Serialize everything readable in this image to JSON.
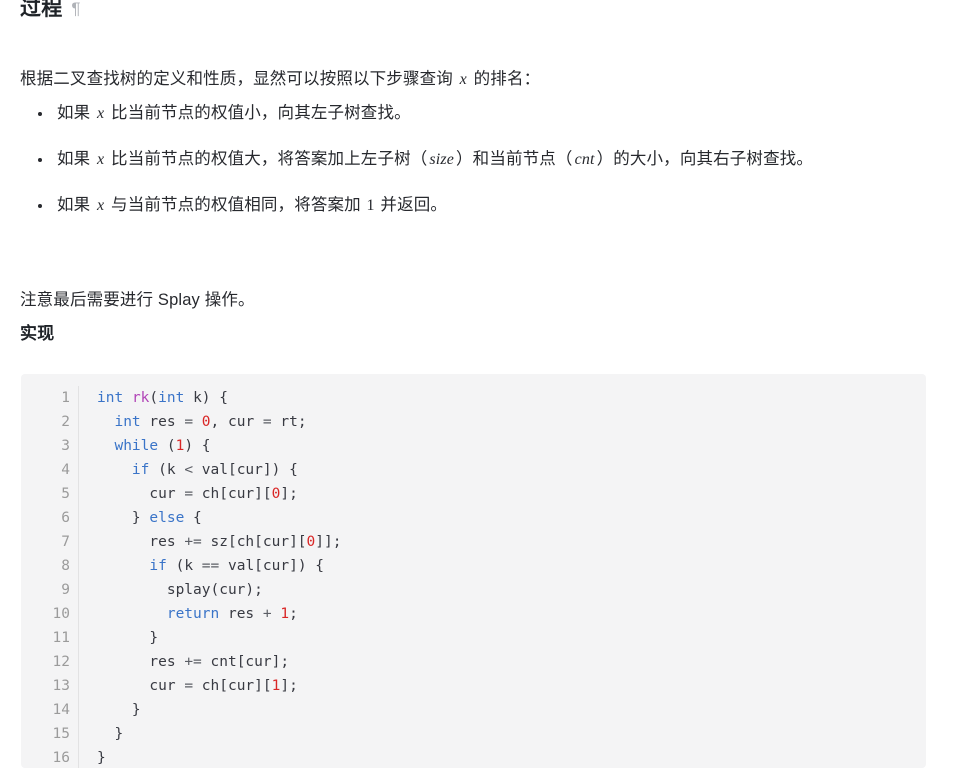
{
  "headings": {
    "section": "过程",
    "pilcrow": "¶",
    "sub": "实现"
  },
  "intro": {
    "before_var": "根据二叉查找树的定义和性质，显然可以按照以下步骤查询 ",
    "var": "x",
    "after_var": " 的排名："
  },
  "bullets": [
    {
      "p1": "如果 ",
      "m1": "x",
      "p2": " 比当前节点的权值小，向其左子树查找。",
      "m2": "",
      "p3": "",
      "m3": "",
      "p4": ""
    },
    {
      "p1": "如果 ",
      "m1": "x",
      "p2": " 比当前节点的权值大，将答案加上左子树（",
      "m2": "size",
      "p3": "）和当前节点（",
      "m3": "cnt",
      "p4": "）的大小，向其右子树查找。"
    },
    {
      "p1": "如果 ",
      "m1": "x",
      "p2": " 与当前节点的权值相同，将答案加 ",
      "m2": "1",
      "p3": " 并返回。",
      "m3": "",
      "p4": ""
    }
  ],
  "splay_note": "注意最后需要进行 Splay 操作。",
  "code": {
    "language": "cpp",
    "line_numbers": [
      "1",
      "2",
      "3",
      "4",
      "5",
      "6",
      "7",
      "8",
      "9",
      "10",
      "11",
      "12",
      "13",
      "14",
      "15",
      "16"
    ],
    "lines": [
      [
        {
          "t": "int",
          "c": "kw"
        },
        {
          "t": " ",
          "c": "pl"
        },
        {
          "t": "rk",
          "c": "fn"
        },
        {
          "t": "(",
          "c": "pl"
        },
        {
          "t": "int",
          "c": "kw"
        },
        {
          "t": " k) {",
          "c": "pl"
        }
      ],
      [
        {
          "t": "  ",
          "c": "pl"
        },
        {
          "t": "int",
          "c": "kw"
        },
        {
          "t": " res ",
          "c": "pl"
        },
        {
          "t": "=",
          "c": "op"
        },
        {
          "t": " ",
          "c": "pl"
        },
        {
          "t": "0",
          "c": "num"
        },
        {
          "t": ", cur ",
          "c": "pl"
        },
        {
          "t": "=",
          "c": "op"
        },
        {
          "t": " rt;",
          "c": "pl"
        }
      ],
      [
        {
          "t": "  ",
          "c": "pl"
        },
        {
          "t": "while",
          "c": "kw"
        },
        {
          "t": " (",
          "c": "pl"
        },
        {
          "t": "1",
          "c": "num"
        },
        {
          "t": ") {",
          "c": "pl"
        }
      ],
      [
        {
          "t": "    ",
          "c": "pl"
        },
        {
          "t": "if",
          "c": "kw"
        },
        {
          "t": " (k ",
          "c": "pl"
        },
        {
          "t": "<",
          "c": "op"
        },
        {
          "t": " val[cur]) {",
          "c": "pl"
        }
      ],
      [
        {
          "t": "      cur ",
          "c": "pl"
        },
        {
          "t": "=",
          "c": "op"
        },
        {
          "t": " ch[cur][",
          "c": "pl"
        },
        {
          "t": "0",
          "c": "num"
        },
        {
          "t": "];",
          "c": "pl"
        }
      ],
      [
        {
          "t": "    } ",
          "c": "pl"
        },
        {
          "t": "else",
          "c": "kw"
        },
        {
          "t": " {",
          "c": "pl"
        }
      ],
      [
        {
          "t": "      res ",
          "c": "pl"
        },
        {
          "t": "+=",
          "c": "op"
        },
        {
          "t": " sz[ch[cur][",
          "c": "pl"
        },
        {
          "t": "0",
          "c": "num"
        },
        {
          "t": "]];",
          "c": "pl"
        }
      ],
      [
        {
          "t": "      ",
          "c": "pl"
        },
        {
          "t": "if",
          "c": "kw"
        },
        {
          "t": " (k ",
          "c": "pl"
        },
        {
          "t": "==",
          "c": "op"
        },
        {
          "t": " val[cur]) {",
          "c": "pl"
        }
      ],
      [
        {
          "t": "        splay(cur);",
          "c": "pl"
        }
      ],
      [
        {
          "t": "        ",
          "c": "pl"
        },
        {
          "t": "return",
          "c": "kw"
        },
        {
          "t": " res ",
          "c": "pl"
        },
        {
          "t": "+",
          "c": "op"
        },
        {
          "t": " ",
          "c": "pl"
        },
        {
          "t": "1",
          "c": "num"
        },
        {
          "t": ";",
          "c": "pl"
        }
      ],
      [
        {
          "t": "      }",
          "c": "pl"
        }
      ],
      [
        {
          "t": "      res ",
          "c": "pl"
        },
        {
          "t": "+=",
          "c": "op"
        },
        {
          "t": " cnt[cur];",
          "c": "pl"
        }
      ],
      [
        {
          "t": "      cur ",
          "c": "pl"
        },
        {
          "t": "=",
          "c": "op"
        },
        {
          "t": " ch[cur][",
          "c": "pl"
        },
        {
          "t": "1",
          "c": "num"
        },
        {
          "t": "];",
          "c": "pl"
        }
      ],
      [
        {
          "t": "    }",
          "c": "pl"
        }
      ],
      [
        {
          "t": "  }",
          "c": "pl"
        }
      ],
      [
        {
          "t": "}",
          "c": "pl"
        }
      ]
    ]
  },
  "colors": {
    "code_background": "#f4f4f5",
    "keyword": "#3a74c8",
    "function": "#b144b7",
    "number": "#d92626",
    "plain": "#383a42",
    "gutter": "#9b9b9b",
    "text": "#27292e"
  }
}
